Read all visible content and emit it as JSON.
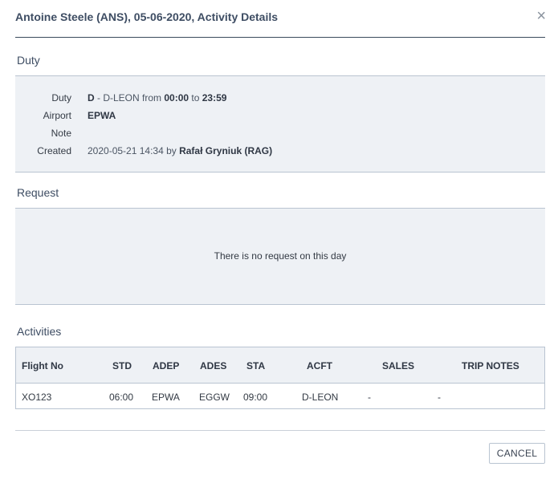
{
  "dialog": {
    "title": "Antoine Steele (ANS), 05-06-2020, Activity Details",
    "close_glyph": "×"
  },
  "duty": {
    "section_title": "Duty",
    "rows": {
      "duty": {
        "label": "Duty",
        "code": "D",
        "desc": " - D-LEON from ",
        "from": "00:00",
        "to_word": " to ",
        "to": "23:59"
      },
      "airport": {
        "label": "Airport",
        "value": "EPWA"
      },
      "note": {
        "label": "Note",
        "value": ""
      },
      "created": {
        "label": "Created",
        "datetime": "2020-05-21 14:34 by ",
        "by": "Rafał Gryniuk (RAG)"
      }
    }
  },
  "request": {
    "section_title": "Request",
    "empty_text": "There is no request on this day"
  },
  "activities": {
    "section_title": "Activities",
    "columns": {
      "flight_no": "Flight No",
      "std": "STD",
      "adep": "ADEP",
      "ades": "ADES",
      "sta": "STA",
      "acft": "ACFT",
      "sales": "SALES",
      "trip_notes": "TRIP NOTES"
    },
    "rows": [
      {
        "flight_no": "XO123",
        "std": "06:00",
        "adep": "EPWA",
        "ades": "EGGW",
        "sta": "09:00",
        "acft": "D-LEON",
        "sales": "-",
        "trip_notes": "-"
      }
    ]
  },
  "footer": {
    "cancel_label": "CANCEL"
  },
  "colors": {
    "title": "#3e4d63",
    "panel_bg": "#eef1f5",
    "border": "#b9c4d1"
  }
}
